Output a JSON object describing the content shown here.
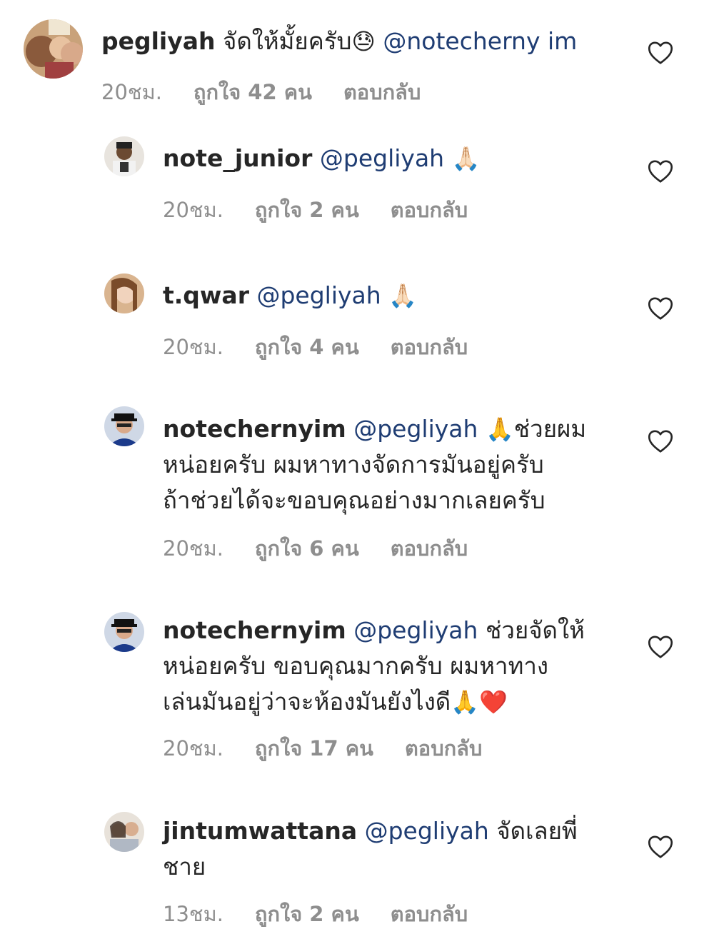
{
  "comments": [
    {
      "username": "pegliyah",
      "text": "จัดให้มั้ยครับ",
      "emoji": "😓",
      "mention": "@notecherny im",
      "time": "20ชม.",
      "likes": "ถูกใจ 42 คน",
      "reply": "ตอบกลับ"
    },
    {
      "username": "note_junior",
      "mention": "@pegliyah",
      "emoji": "🙏🏻",
      "time": "20ชม.",
      "likes": "ถูกใจ 2 คน",
      "reply": "ตอบกลับ"
    },
    {
      "username": "t.qwar",
      "mention": "@pegliyah",
      "emoji": "🙏🏻",
      "time": "20ชม.",
      "likes": "ถูกใจ 4 คน",
      "reply": "ตอบกลับ"
    },
    {
      "username": "notechernyim",
      "mention": "@pegliyah",
      "emoji": "🙏",
      "text_line1": "ช่วยผม",
      "text_line2": "หน่อยครับ ผมหาทางจัดการมันอยู่ครับ",
      "text_line3": "ถ้าช่วยได้จะขอบคุณอย่างมากเลยครับ",
      "time": "20ชม.",
      "likes": "ถูกใจ 6 คน",
      "reply": "ตอบกลับ"
    },
    {
      "username": "notechernyim",
      "mention": "@pegliyah",
      "text_line1": "ช่วยจัดให้",
      "text_line2": "หน่อยครับ ขอบคุณมากครับ ผมหาทาง",
      "text_line3": "เล่นมันอยู่ว่าจะห้องมันยังไงดี",
      "emoji": "🙏",
      "emoji2": "❤️",
      "time": "20ชม.",
      "likes": "ถูกใจ 17 คน",
      "reply": "ตอบกลับ"
    },
    {
      "username": "jintumwattana",
      "mention": "@pegliyah",
      "text_line1": "จัดเลยพี่",
      "text_line2": "ชาย",
      "time": "13ชม.",
      "likes": "ถูกใจ 2 คน",
      "reply": "ตอบกลับ"
    }
  ],
  "icons": {
    "like": "heart-outline-icon"
  },
  "colors": {
    "text": "#262626",
    "mention": "#1f3d73",
    "meta": "#8e8e8e"
  }
}
